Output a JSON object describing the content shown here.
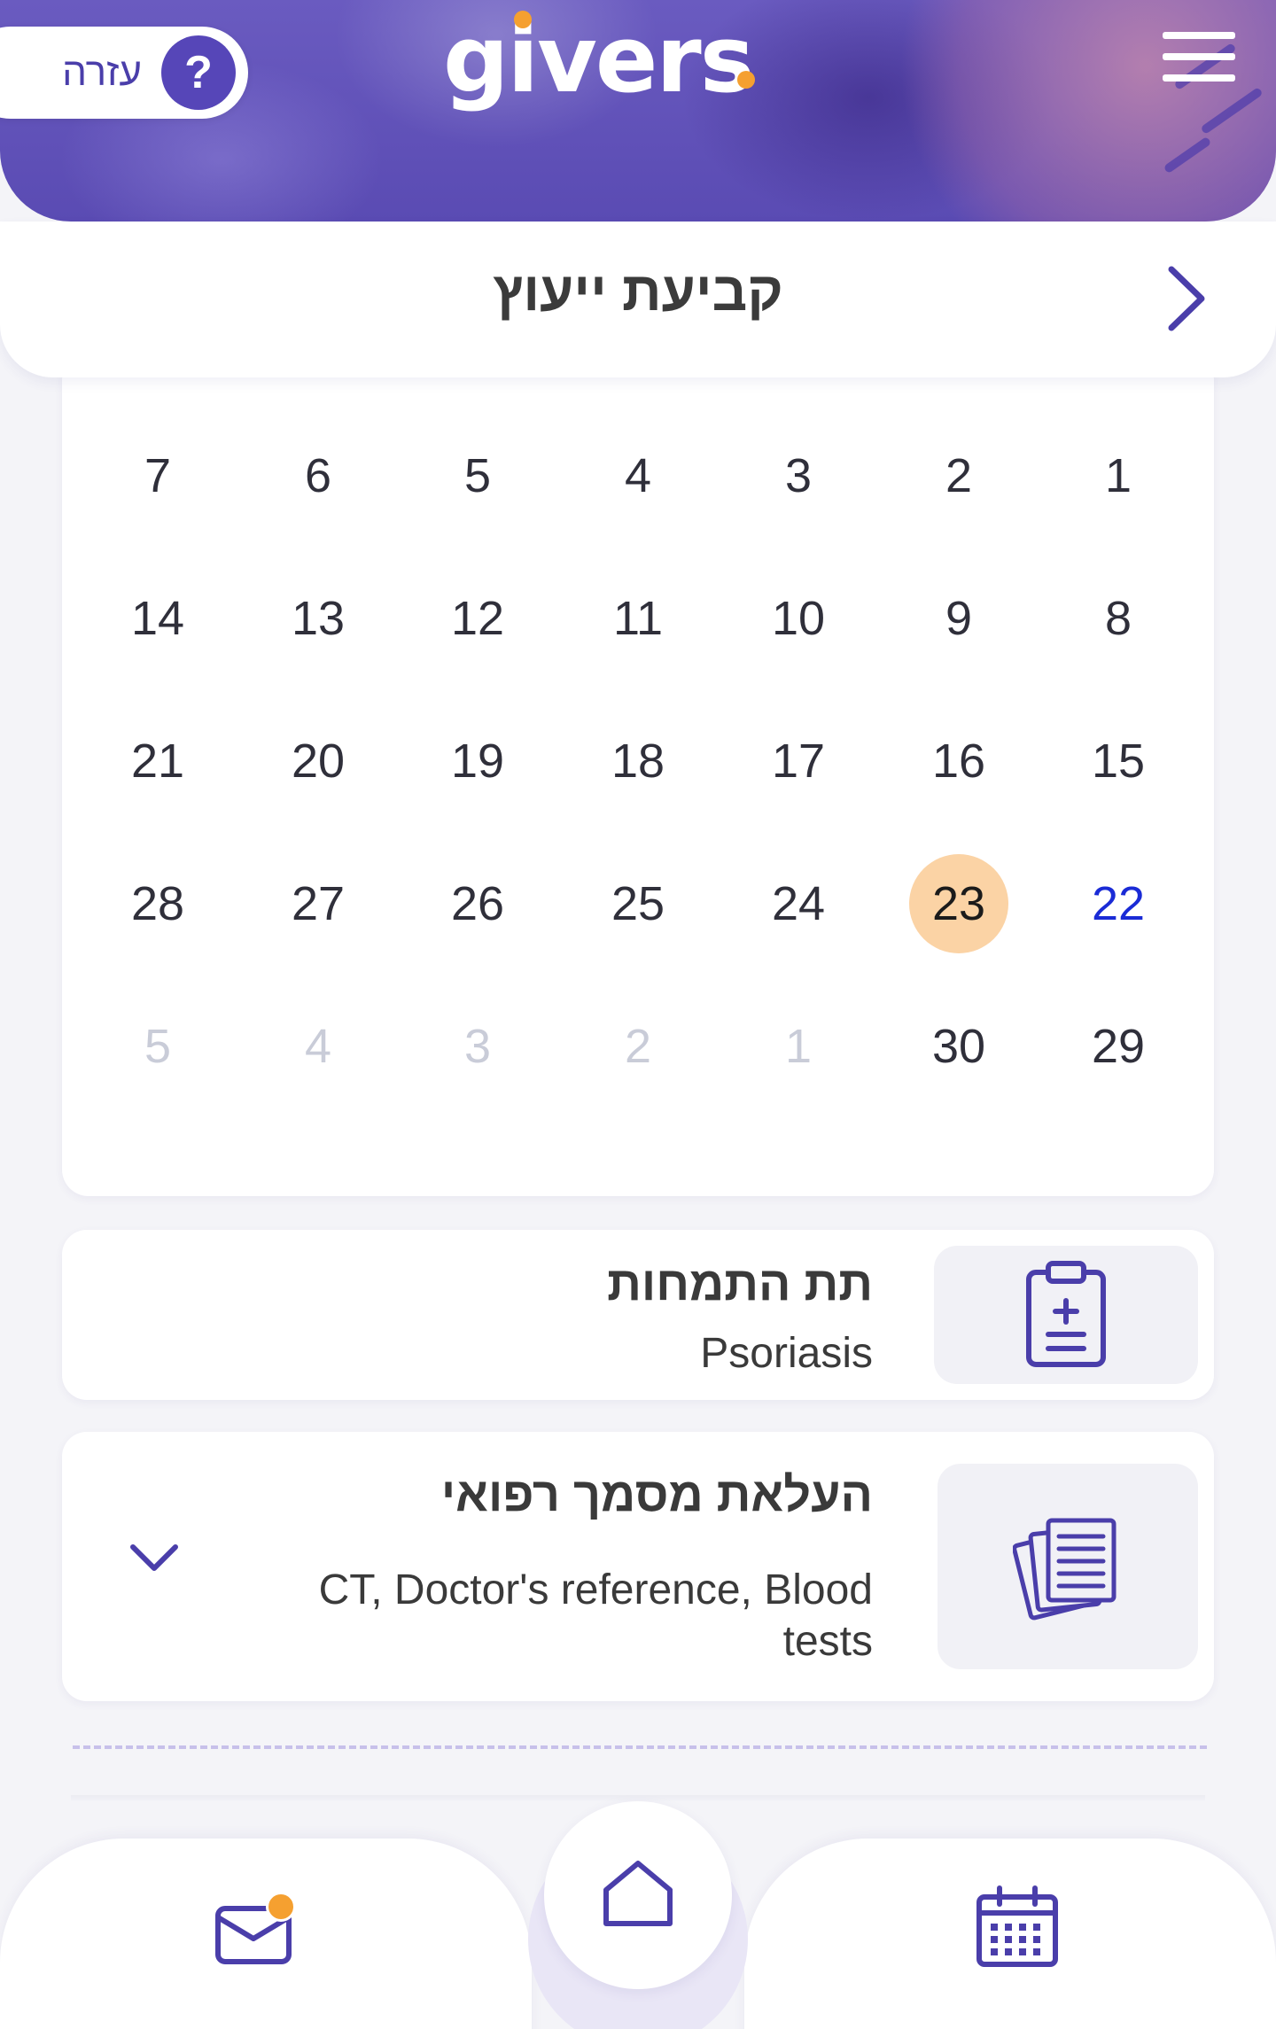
{
  "header": {
    "help_label": "עזרה",
    "help_symbol": "?",
    "logo_text": "givers",
    "menu_icon": "hamburger-menu-icon"
  },
  "title_bar": {
    "title": "קביעת ייעוץ",
    "back_icon": "chevron-right-icon"
  },
  "calendar": {
    "weeks": [
      [
        "7",
        "6",
        "5",
        "4",
        "3",
        "2",
        "1"
      ],
      [
        "14",
        "13",
        "12",
        "11",
        "10",
        "9",
        "8"
      ],
      [
        "21",
        "20",
        "19",
        "18",
        "17",
        "16",
        "15"
      ],
      [
        "28",
        "27",
        "26",
        "25",
        "24",
        "23",
        "22"
      ],
      [
        "5",
        "4",
        "3",
        "2",
        "1",
        "30",
        "29"
      ]
    ],
    "selected_day": "23",
    "today_day": "22",
    "next_month_days": [
      "1",
      "2",
      "3",
      "4",
      "5"
    ],
    "colors": {
      "selected_bg": "#fbd3a5",
      "today_text": "#1a2bd6",
      "muted_text": "#c9ccd8"
    }
  },
  "condition_card": {
    "title": "תת התמחות",
    "value": "Psoriasis",
    "icon": "clipboard-plus-icon"
  },
  "documents_card": {
    "title": "העלאת מסמך רפואי",
    "value": "CT, Doctor's reference, Blood tests",
    "icon": "documents-stack-icon",
    "expand_icon": "chevron-down-icon"
  },
  "bottom_nav": {
    "items": [
      {
        "name": "messages",
        "icon": "mail-icon",
        "has_notification": true
      },
      {
        "name": "home",
        "icon": "home-icon"
      },
      {
        "name": "appointments",
        "icon": "calendar-icon"
      }
    ]
  },
  "colors": {
    "brand_purple": "#5646b8",
    "accent_orange": "#f5a030",
    "background": "#f4f4f8"
  }
}
